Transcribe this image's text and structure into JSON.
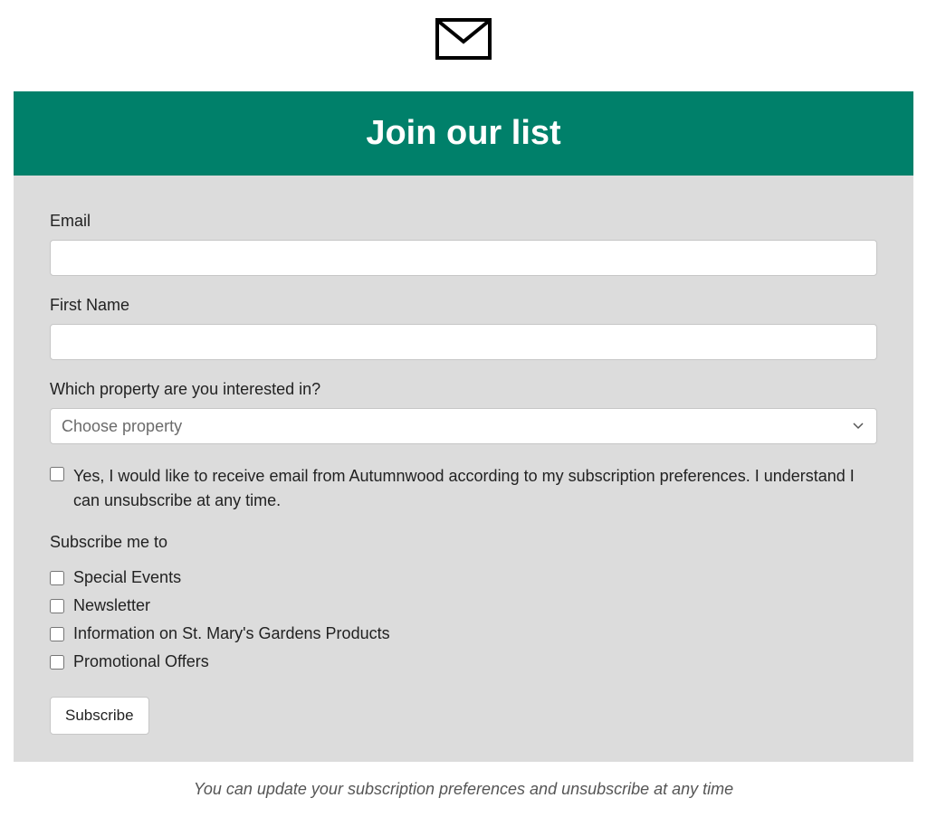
{
  "header": {
    "title": "Join our list"
  },
  "form": {
    "email_label": "Email",
    "email_value": "",
    "firstname_label": "First Name",
    "firstname_value": "",
    "property_label": "Which property are you interested in?",
    "property_selected": "Choose property",
    "consent_text": "Yes, I would like to receive email from Autumnwood according to my subscription preferences. I understand I can unsubscribe at any time.",
    "subscribe_heading": "Subscribe me to",
    "options": [
      "Special Events",
      "Newsletter",
      "Information on St. Mary's Gardens Products",
      "Promotional Offers"
    ],
    "submit_label": "Subscribe"
  },
  "footer": {
    "note": "You can update your subscription preferences and unsubscribe at any time"
  }
}
